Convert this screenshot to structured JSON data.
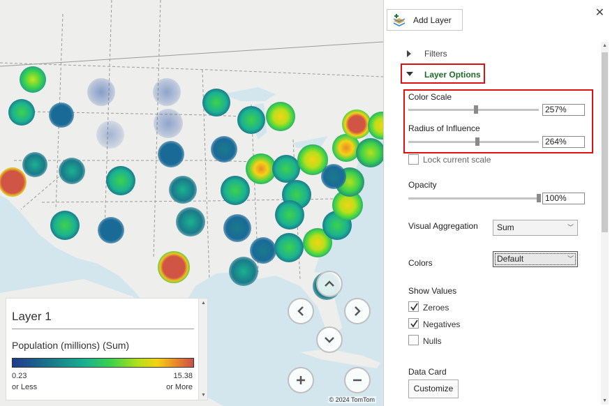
{
  "map": {
    "copyright": "© 2024 TomTom",
    "legend": {
      "title": "Layer 1",
      "subtitle": "Population (millions) (Sum)",
      "min_value": "0.23",
      "min_label": "or Less",
      "max_value": "15.38",
      "max_label": "or More"
    },
    "nav_icons": [
      "chevron-up-icon",
      "chevron-left-icon",
      "chevron-right-icon",
      "chevron-down-icon",
      "zoom-in-icon",
      "zoom-out-icon"
    ]
  },
  "panel": {
    "add_layer_label": "Add Layer",
    "close_glyph": "✕",
    "filters_label": "Filters",
    "layer_options_label": "Layer Options",
    "color_scale": {
      "label": "Color Scale",
      "value": "257%",
      "level": 0.52
    },
    "radius": {
      "label": "Radius of Influence",
      "value": "264%",
      "level": 0.53
    },
    "lock_scale_label": "Lock current scale",
    "opacity": {
      "label": "Opacity",
      "value": "100%",
      "level": 1.0
    },
    "visual_aggregation": {
      "label": "Visual Aggregation",
      "selected": "Sum"
    },
    "colors": {
      "label": "Colors",
      "selected": "Default"
    },
    "show_values": {
      "label": "Show Values",
      "options": [
        {
          "label": "Zeroes",
          "checked": true
        },
        {
          "label": "Negatives",
          "checked": true
        },
        {
          "label": "Nulls",
          "checked": false
        }
      ]
    },
    "data_card": {
      "label": "Data Card",
      "button": "Customize"
    }
  },
  "colors": {
    "accent_green": "#1f6b2a",
    "highlight_red": "#e01010"
  }
}
